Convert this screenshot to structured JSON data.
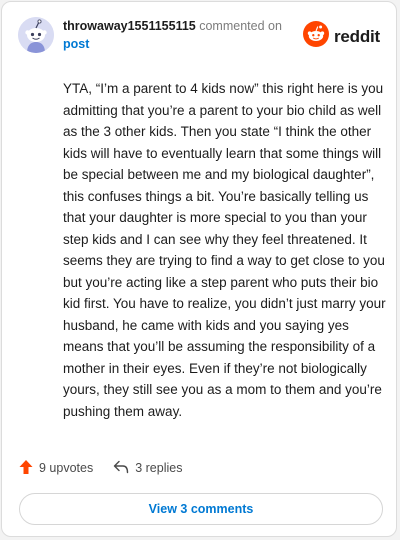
{
  "header": {
    "username": "throwaway1551155115",
    "action_text": "commented on",
    "post_link": "post",
    "brand": "reddit"
  },
  "comment": {
    "body": "YTA, “I’m a parent to 4 kids now” this right here is you admitting that you’re a parent to your bio child as well as the 3 other kids. Then you state “I think the other kids will have to eventually learn that some things will be special between me and my biological daughter”, this confuses things a bit. You’re basically telling us that your daughter is more special to you than your step kids and I can see why they feel threatened. It seems they are trying to find a way to get close to you but you’re acting like a step parent who puts their bio kid first. You have to realize, you didn’t just marry your husband, he came with kids and you saying yes means that you’ll be assuming the responsibility of a mother in their eyes. Even if they’re not biologically yours, they still see you as a mom to them and you’re pushing them away."
  },
  "actions": {
    "upvotes_label": "9 upvotes",
    "replies_label": "3 replies"
  },
  "footer": {
    "view_comments_label": "View 3 comments"
  },
  "icons": {
    "avatar": "snoo-avatar-icon",
    "logo": "reddit-snoo-icon",
    "upvote": "upvote-arrow-icon",
    "reply": "reply-arrow-icon"
  },
  "colors": {
    "brand_orange": "#ff4500",
    "link_blue": "#0079d3",
    "upvote": "#ff4500"
  }
}
